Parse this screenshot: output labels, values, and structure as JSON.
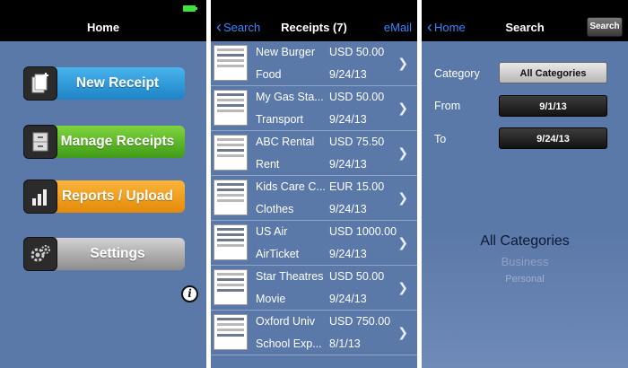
{
  "home": {
    "title": "Home",
    "buttons": {
      "new_receipt": "New Receipt",
      "manage_receipts": "Manage Receipts",
      "reports_upload": "Reports / Upload",
      "settings": "Settings"
    },
    "info_glyph": "i"
  },
  "receipts": {
    "back_label": "Search",
    "title": "Receipts (7)",
    "action_label": "eMail",
    "items": [
      {
        "name": "New Burger",
        "amount": "USD 50.00",
        "category": "Food",
        "date": "9/24/13"
      },
      {
        "name": "My Gas Sta...",
        "amount": "USD 50.00",
        "category": "Transport",
        "date": "9/24/13"
      },
      {
        "name": "ABC Rental",
        "amount": "USD 75.50",
        "category": "Rent",
        "date": "9/24/13"
      },
      {
        "name": "Kids Care C...",
        "amount": "EUR 15.00",
        "category": "Clothes",
        "date": "9/24/13"
      },
      {
        "name": "US Air",
        "amount": "USD 1000.00",
        "category": "AirTicket",
        "date": "9/24/13"
      },
      {
        "name": "Star Theatres",
        "amount": "USD 50.00",
        "category": "Movie",
        "date": "9/24/13"
      },
      {
        "name": "Oxford Univ",
        "amount": "USD 750.00",
        "category": "School Exp...",
        "date": "8/1/13"
      }
    ]
  },
  "search": {
    "back_label": "Home",
    "title": "Search",
    "search_button": "Search",
    "fields": {
      "category_label": "Category",
      "category_value": "All Categories",
      "from_label": "From",
      "from_value": "9/1/13",
      "to_label": "To",
      "to_value": "9/24/13"
    },
    "picker": {
      "selected": "All Categories",
      "option1": "Business",
      "option2": "Personal"
    }
  }
}
